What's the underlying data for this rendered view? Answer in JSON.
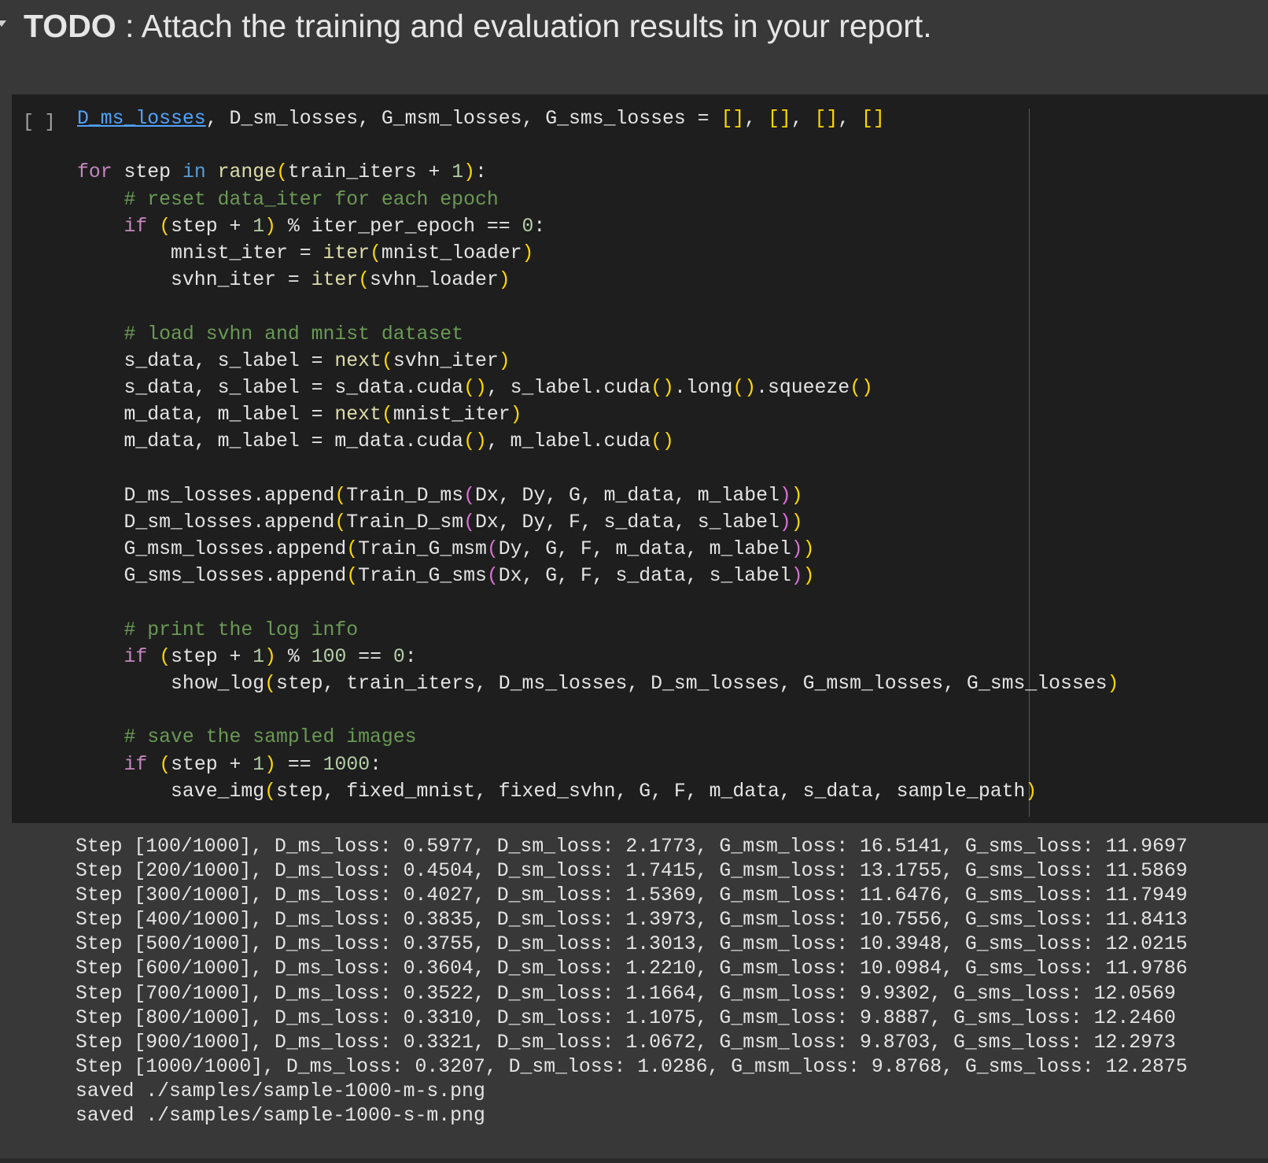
{
  "markdown": {
    "todo": "TODO",
    "rest": " : Attach the training and evaluation results in your report."
  },
  "code_cell": {
    "run_label": "[ ]",
    "lines": [
      {
        "indent": 0,
        "t": [
          [
            "link",
            "D_ms_losses"
          ],
          [
            "p",
            ", D_sm_losses, G_msm_losses, G_sms_losses = "
          ],
          [
            "b1",
            "[]"
          ],
          [
            "p",
            ", "
          ],
          [
            "b1",
            "[]"
          ],
          [
            "p",
            ", "
          ],
          [
            "b1",
            "[]"
          ],
          [
            "p",
            ", "
          ],
          [
            "b1",
            "[]"
          ]
        ]
      },
      {
        "indent": 0,
        "t": []
      },
      {
        "indent": 0,
        "t": [
          [
            "kw",
            "for"
          ],
          [
            "p",
            " step "
          ],
          [
            "sb",
            "in"
          ],
          [
            "p",
            " "
          ],
          [
            "bi",
            "range"
          ],
          [
            "b1",
            "("
          ],
          [
            "p",
            "train_iters + "
          ],
          [
            "num",
            "1"
          ],
          [
            "b1",
            ")"
          ],
          [
            "p",
            ":"
          ]
        ]
      },
      {
        "indent": 1,
        "t": [
          [
            "cm",
            "# reset data_iter for each epoch"
          ]
        ]
      },
      {
        "indent": 1,
        "t": [
          [
            "kw",
            "if"
          ],
          [
            "p",
            " "
          ],
          [
            "b1",
            "("
          ],
          [
            "p",
            "step + "
          ],
          [
            "num",
            "1"
          ],
          [
            "b1",
            ")"
          ],
          [
            "p",
            " % iter_per_epoch == "
          ],
          [
            "num",
            "0"
          ],
          [
            "p",
            ":"
          ]
        ]
      },
      {
        "indent": 2,
        "t": [
          [
            "p",
            "mnist_iter = "
          ],
          [
            "bi",
            "iter"
          ],
          [
            "b1",
            "("
          ],
          [
            "p",
            "mnist_loader"
          ],
          [
            "b1",
            ")"
          ]
        ]
      },
      {
        "indent": 2,
        "t": [
          [
            "p",
            "svhn_iter = "
          ],
          [
            "bi",
            "iter"
          ],
          [
            "b1",
            "("
          ],
          [
            "p",
            "svhn_loader"
          ],
          [
            "b1",
            ")"
          ]
        ]
      },
      {
        "indent": 0,
        "t": []
      },
      {
        "indent": 1,
        "t": [
          [
            "cm",
            "# load svhn and mnist dataset"
          ]
        ]
      },
      {
        "indent": 1,
        "t": [
          [
            "p",
            "s_data, s_label = "
          ],
          [
            "bi",
            "next"
          ],
          [
            "b1",
            "("
          ],
          [
            "p",
            "svhn_iter"
          ],
          [
            "b1",
            ")"
          ]
        ]
      },
      {
        "indent": 1,
        "t": [
          [
            "p",
            "s_data, s_label = s_data.cuda"
          ],
          [
            "b1",
            "()"
          ],
          [
            "p",
            ", s_label.cuda"
          ],
          [
            "b1",
            "()"
          ],
          [
            "p",
            ".long"
          ],
          [
            "b1",
            "()"
          ],
          [
            "p",
            ".squeeze"
          ],
          [
            "b1",
            "()"
          ]
        ]
      },
      {
        "indent": 1,
        "t": [
          [
            "p",
            "m_data, m_label = "
          ],
          [
            "bi",
            "next"
          ],
          [
            "b1",
            "("
          ],
          [
            "p",
            "mnist_iter"
          ],
          [
            "b1",
            ")"
          ]
        ]
      },
      {
        "indent": 1,
        "t": [
          [
            "p",
            "m_data, m_label = m_data.cuda"
          ],
          [
            "b1",
            "()"
          ],
          [
            "p",
            ", m_label.cuda"
          ],
          [
            "b1",
            "()"
          ]
        ]
      },
      {
        "indent": 0,
        "t": []
      },
      {
        "indent": 1,
        "t": [
          [
            "p",
            "D_ms_losses.append"
          ],
          [
            "b1",
            "("
          ],
          [
            "p",
            "Train_D_ms"
          ],
          [
            "b2",
            "("
          ],
          [
            "p",
            "Dx, Dy, G, m_data, m_label"
          ],
          [
            "b2",
            ")"
          ],
          [
            "b1",
            ")"
          ]
        ]
      },
      {
        "indent": 1,
        "t": [
          [
            "p",
            "D_sm_losses.append"
          ],
          [
            "b1",
            "("
          ],
          [
            "p",
            "Train_D_sm"
          ],
          [
            "b2",
            "("
          ],
          [
            "p",
            "Dx, Dy, F, s_data, s_label"
          ],
          [
            "b2",
            ")"
          ],
          [
            "b1",
            ")"
          ]
        ]
      },
      {
        "indent": 1,
        "t": [
          [
            "p",
            "G_msm_losses.append"
          ],
          [
            "b1",
            "("
          ],
          [
            "p",
            "Train_G_msm"
          ],
          [
            "b2",
            "("
          ],
          [
            "p",
            "Dy, G, F, m_data, m_label"
          ],
          [
            "b2",
            ")"
          ],
          [
            "b1",
            ")"
          ]
        ]
      },
      {
        "indent": 1,
        "t": [
          [
            "p",
            "G_sms_losses.append"
          ],
          [
            "b1",
            "("
          ],
          [
            "p",
            "Train_G_sms"
          ],
          [
            "b2",
            "("
          ],
          [
            "p",
            "Dx, G, F, s_data, s_label"
          ],
          [
            "b2",
            ")"
          ],
          [
            "b1",
            ")"
          ]
        ]
      },
      {
        "indent": 0,
        "t": []
      },
      {
        "indent": 1,
        "t": [
          [
            "cm",
            "# print the log info"
          ]
        ]
      },
      {
        "indent": 1,
        "t": [
          [
            "kw",
            "if"
          ],
          [
            "p",
            " "
          ],
          [
            "b1",
            "("
          ],
          [
            "p",
            "step + "
          ],
          [
            "num",
            "1"
          ],
          [
            "b1",
            ")"
          ],
          [
            "p",
            " % "
          ],
          [
            "num",
            "100"
          ],
          [
            "p",
            " == "
          ],
          [
            "num",
            "0"
          ],
          [
            "p",
            ":"
          ]
        ]
      },
      {
        "indent": 2,
        "t": [
          [
            "p",
            "show_log"
          ],
          [
            "b1",
            "("
          ],
          [
            "p",
            "step, train_iters, D_ms_losses, D_sm_losses, G_msm_losses, G_sms_losses"
          ],
          [
            "b1",
            ")"
          ]
        ]
      },
      {
        "indent": 0,
        "t": []
      },
      {
        "indent": 1,
        "t": [
          [
            "cm",
            "# save the sampled images"
          ]
        ]
      },
      {
        "indent": 1,
        "t": [
          [
            "kw",
            "if"
          ],
          [
            "p",
            " "
          ],
          [
            "b1",
            "("
          ],
          [
            "p",
            "step + "
          ],
          [
            "num",
            "1"
          ],
          [
            "b1",
            ")"
          ],
          [
            "p",
            " == "
          ],
          [
            "num",
            "1000"
          ],
          [
            "p",
            ":"
          ]
        ]
      },
      {
        "indent": 2,
        "t": [
          [
            "p",
            "save_img"
          ],
          [
            "b1",
            "("
          ],
          [
            "p",
            "step, fixed_mnist, fixed_svhn, G, F, m_data, s_data, sample_path"
          ],
          [
            "b1",
            ")"
          ]
        ]
      }
    ]
  },
  "output": [
    "Step [100/1000], D_ms_loss: 0.5977, D_sm_loss: 2.1773, G_msm_loss: 16.5141, G_sms_loss: 11.9697",
    "Step [200/1000], D_ms_loss: 0.4504, D_sm_loss: 1.7415, G_msm_loss: 13.1755, G_sms_loss: 11.5869",
    "Step [300/1000], D_ms_loss: 0.4027, D_sm_loss: 1.5369, G_msm_loss: 11.6476, G_sms_loss: 11.7949",
    "Step [400/1000], D_ms_loss: 0.3835, D_sm_loss: 1.3973, G_msm_loss: 10.7556, G_sms_loss: 11.8413",
    "Step [500/1000], D_ms_loss: 0.3755, D_sm_loss: 1.3013, G_msm_loss: 10.3948, G_sms_loss: 12.0215",
    "Step [600/1000], D_ms_loss: 0.3604, D_sm_loss: 1.2210, G_msm_loss: 10.0984, G_sms_loss: 11.9786",
    "Step [700/1000], D_ms_loss: 0.3522, D_sm_loss: 1.1664, G_msm_loss: 9.9302, G_sms_loss: 12.0569",
    "Step [800/1000], D_ms_loss: 0.3310, D_sm_loss: 1.1075, G_msm_loss: 9.8887, G_sms_loss: 12.2460",
    "Step [900/1000], D_ms_loss: 0.3321, D_sm_loss: 1.0672, G_msm_loss: 9.8703, G_sms_loss: 12.2973",
    "Step [1000/1000], D_ms_loss: 0.3207, D_sm_loss: 1.0286, G_msm_loss: 9.8768, G_sms_loss: 12.2875",
    "saved ./samples/sample-1000-m-s.png",
    "saved ./samples/sample-1000-s-m.png"
  ]
}
